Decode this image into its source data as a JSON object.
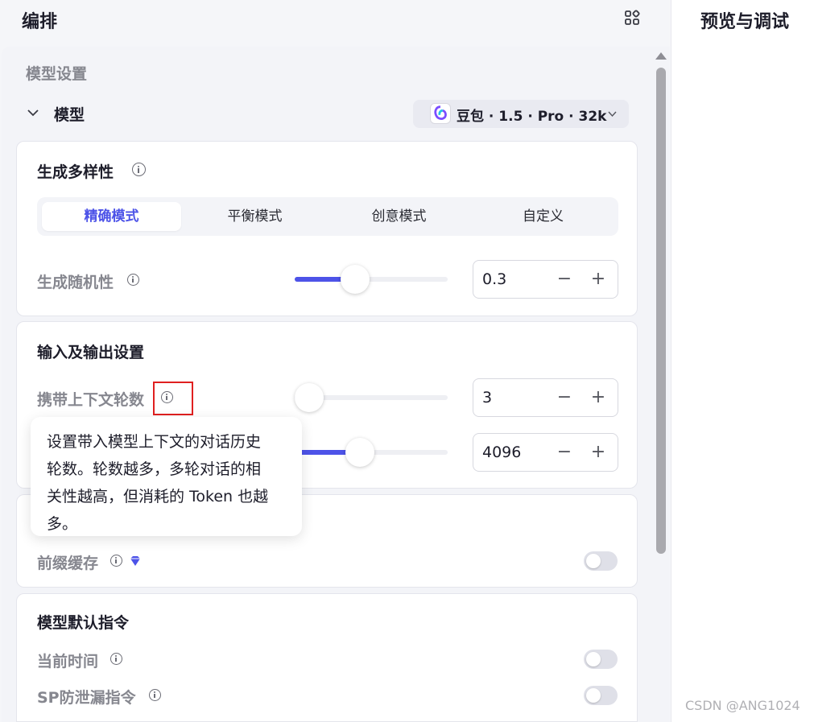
{
  "header": {
    "title": "编排",
    "layout_icon": "grid-icon"
  },
  "right_panel": {
    "title": "预览与调试"
  },
  "model_settings": {
    "section_title": "模型设置",
    "model_label": "模型",
    "model_select": {
      "value": "豆包 · 1.5 · Pro · 32k",
      "logo": "doubao-logo"
    }
  },
  "diversity": {
    "title": "生成多样性",
    "modes": [
      "精确模式",
      "平衡模式",
      "创意模式",
      "自定义"
    ],
    "active_mode": "精确模式",
    "randomness": {
      "label": "生成随机性",
      "value": "0.3",
      "slider_fraction": 0.3
    }
  },
  "io_settings": {
    "title": "输入及输出设置",
    "context_rounds": {
      "label": "携带上下文轮数",
      "value": "3",
      "slider_fraction": 0.0
    },
    "max_tokens": {
      "value": "4096",
      "slider_fraction": 0.33
    }
  },
  "tooltip": {
    "text": "设置带入模型上下文的对话历史轮数。轮数越多，多轮对话的相关性越高，但消耗的 Token 也越多。",
    "lines": [
      "设置带入模型上下文的对话历史",
      "轮数。轮数越多，多轮对话的相",
      "关性越高，但消耗的 Token 也越",
      "多。"
    ]
  },
  "prefix_cache": {
    "label": "前缀缓存",
    "enabled": false,
    "badge_color": "#4d53e8"
  },
  "default_instructions": {
    "title": "模型默认指令",
    "current_time": {
      "label": "当前时间",
      "enabled": false
    },
    "sp_leak": {
      "label": "SP防泄漏指令",
      "enabled": false
    }
  },
  "stepper_minus": "−",
  "stepper_plus": "+",
  "watermark": "CSDN @ANG1024",
  "colors": {
    "accent": "#4d53e8",
    "highlight": "#e02020"
  }
}
